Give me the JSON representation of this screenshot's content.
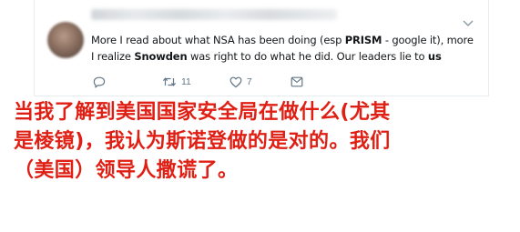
{
  "tweet": {
    "text_parts": [
      {
        "text": "More I read about what NSA has been doing (esp ",
        "bold": false
      },
      {
        "text": "PRISM",
        "bold": true
      },
      {
        "text": " - google it), more I realize ",
        "bold": false
      },
      {
        "text": "Snowden",
        "bold": true
      },
      {
        "text": " was right to do what he did. Our leaders lie to ",
        "bold": false
      },
      {
        "text": "us",
        "bold": true
      }
    ],
    "retweet_count": "11",
    "like_count": "7"
  },
  "caption": {
    "lines": [
      "当我了解到美国国家安全局在做什么(尤其",
      "是棱镜)，我认为斯诺登做的是对的。我们",
      "（美国）领导人撒谎了。"
    ]
  },
  "colors": {
    "caption": "#e01f14",
    "icon_gray": "#657786",
    "text": "#14171a"
  },
  "icons": {
    "reply": "reply-icon",
    "retweet": "retweet-icon",
    "like": "heart-icon",
    "dm": "direct-message-icon",
    "more": "chevron-down-icon"
  }
}
